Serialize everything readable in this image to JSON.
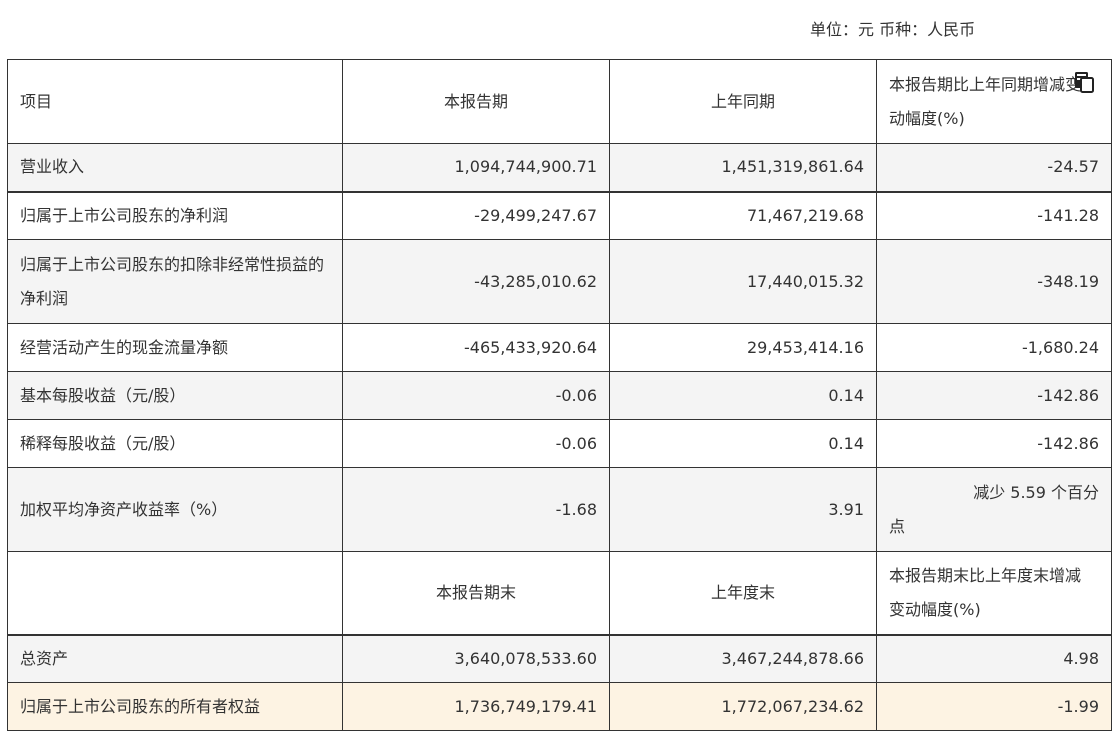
{
  "unit_line": "单位：元 币种：人民币",
  "header": {
    "item": "项目",
    "current": "本报告期",
    "prior": "上年同期",
    "change": "本报告期比上年同期增减变动幅度(%)"
  },
  "rows": [
    {
      "item": "营业收入",
      "current": "1,094,744,900.71",
      "prior": "1,451,319,861.64",
      "change": "-24.57"
    },
    {
      "item": "归属于上市公司股东的净利润",
      "current": "-29,499,247.67",
      "prior": "71,467,219.68",
      "change": "-141.28"
    },
    {
      "item": "归属于上市公司股东的扣除非经常性损益的净利润",
      "current": "-43,285,010.62",
      "prior": "17,440,015.32",
      "change": "-348.19"
    },
    {
      "item": "经营活动产生的现金流量净额",
      "current": "-465,433,920.64",
      "prior": "29,453,414.16",
      "change": "-1,680.24"
    },
    {
      "item": "基本每股收益（元/股）",
      "current": "-0.06",
      "prior": "0.14",
      "change": "-142.86"
    },
    {
      "item": "稀释每股收益（元/股）",
      "current": "-0.06",
      "prior": "0.14",
      "change": "-142.86"
    },
    {
      "item": "加权平均净资产收益率（%）",
      "current": "-1.68",
      "prior": "3.91",
      "change_line1": "减少 5.59 个百分",
      "change_line2": "点"
    }
  ],
  "header2": {
    "item": "",
    "current": "本报告期末",
    "prior": "上年度末",
    "change_line1": "本报告期末比上年度末增减",
    "change_line2": "变动幅度(%)"
  },
  "rows2": [
    {
      "item": "总资产",
      "current": "3,640,078,533.60",
      "prior": "3,467,244,878.66",
      "change": "4.98"
    },
    {
      "item": "归属于上市公司股东的所有者权益",
      "current": "1,736,749,179.41",
      "prior": "1,772,067,234.62",
      "change": "-1.99"
    }
  ],
  "icons": {
    "copy": "copy-icon"
  }
}
